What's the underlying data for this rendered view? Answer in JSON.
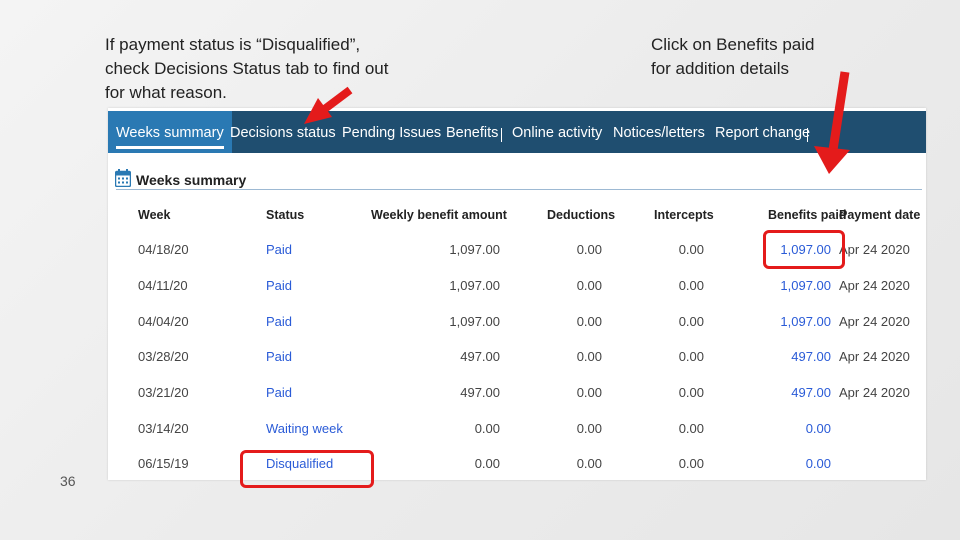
{
  "notes": {
    "left": "If payment status is “Disqualified”,\ncheck Decisions Status tab to find out\nfor what reason.",
    "right": "Click on Benefits paid\nfor addition details"
  },
  "slide_number": "36",
  "nav": {
    "tabs": [
      {
        "label": "Weeks summary",
        "active": true
      },
      {
        "label": "Decisions status"
      },
      {
        "label": "Pending Issues"
      },
      {
        "label": "Benefits"
      },
      {
        "label": "Online activity"
      },
      {
        "label": "Notices/letters"
      },
      {
        "label": "Report change"
      }
    ]
  },
  "section": {
    "title": "Weeks summary",
    "icon": "calendar-icon"
  },
  "table": {
    "headers": [
      "Week",
      "Status",
      "Weekly benefit amount",
      "Deductions",
      "Intercepts",
      "Benefits paid",
      "Payment date"
    ],
    "rows": [
      {
        "week": "04/18/20",
        "status": "Paid",
        "amount": "1,097.00",
        "deductions": "0.00",
        "intercepts": "0.00",
        "paid": "1,097.00",
        "date": "Apr 24 2020"
      },
      {
        "week": "04/11/20",
        "status": "Paid",
        "amount": "1,097.00",
        "deductions": "0.00",
        "intercepts": "0.00",
        "paid": "1,097.00",
        "date": "Apr 24 2020"
      },
      {
        "week": "04/04/20",
        "status": "Paid",
        "amount": "1,097.00",
        "deductions": "0.00",
        "intercepts": "0.00",
        "paid": "1,097.00",
        "date": "Apr 24 2020"
      },
      {
        "week": "03/28/20",
        "status": "Paid",
        "amount": "497.00",
        "deductions": "0.00",
        "intercepts": "0.00",
        "paid": "497.00",
        "date": "Apr 24 2020"
      },
      {
        "week": "03/21/20",
        "status": "Paid",
        "amount": "497.00",
        "deductions": "0.00",
        "intercepts": "0.00",
        "paid": "497.00",
        "date": "Apr 24 2020"
      },
      {
        "week": "03/14/20",
        "status": "Waiting week",
        "amount": "0.00",
        "deductions": "0.00",
        "intercepts": "0.00",
        "paid": "0.00",
        "date": ""
      },
      {
        "week": "06/15/19",
        "status": "Disqualified",
        "amount": "0.00",
        "deductions": "0.00",
        "intercepts": "0.00",
        "paid": "0.00",
        "date": ""
      }
    ]
  },
  "colors": {
    "nav_bg": "#1f4e70",
    "active_tab": "#2a79b3",
    "link": "#2a5bd7",
    "highlight": "#e41b1b"
  }
}
